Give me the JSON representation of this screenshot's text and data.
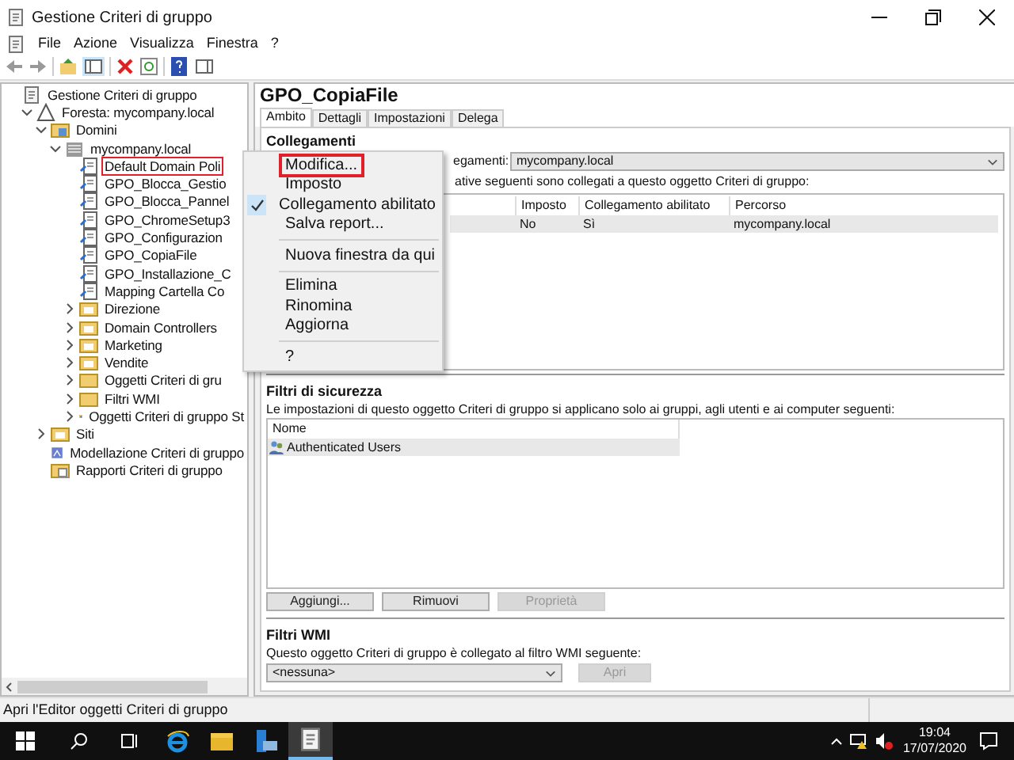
{
  "window": {
    "title": "Gestione Criteri di gruppo"
  },
  "menu_bar": [
    "File",
    "Azione",
    "Visualizza",
    "Finestra",
    "?"
  ],
  "tree": [
    {
      "label": "Gestione Criteri di gruppo",
      "kind": "root",
      "selected": false,
      "children": [
        {
          "label": "Foresta: mycompany.local",
          "kind": "forest",
          "expanded": true,
          "selected": false,
          "children": [
            {
              "label": "Domini",
              "kind": "domains",
              "expanded": true,
              "selected": false,
              "children": [
                {
                  "label": "mycompany.local",
                  "kind": "domain",
                  "expanded": true,
                  "selected": false,
                  "children": [
                    {
                      "label": "Default Domain Poli",
                      "kind": "link",
                      "selected": true
                    },
                    {
                      "label": "GPO_Blocca_Gestio",
                      "kind": "link",
                      "selected": false
                    },
                    {
                      "label": "GPO_Blocca_Pannel",
                      "kind": "link",
                      "selected": false
                    },
                    {
                      "label": "GPO_ChromeSetup3",
                      "kind": "link",
                      "selected": false
                    },
                    {
                      "label": "GPO_Configurazion",
                      "kind": "link",
                      "selected": false
                    },
                    {
                      "label": "GPO_CopiaFile",
                      "kind": "link",
                      "selected": false
                    },
                    {
                      "label": "GPO_Installazione_C",
                      "kind": "link",
                      "selected": false
                    },
                    {
                      "label": "Mapping Cartella Co",
                      "kind": "link",
                      "selected": false
                    },
                    {
                      "label": "Direzione",
                      "kind": "ou",
                      "expanded": false,
                      "selected": false
                    },
                    {
                      "label": "Domain Controllers",
                      "kind": "ou",
                      "expanded": false,
                      "selected": false
                    },
                    {
                      "label": "Marketing",
                      "kind": "ou",
                      "expanded": false,
                      "selected": false
                    },
                    {
                      "label": "Vendite",
                      "kind": "ou",
                      "expanded": false,
                      "selected": false
                    },
                    {
                      "label": "Oggetti Criteri di gru",
                      "kind": "folder",
                      "expanded": false,
                      "selected": false
                    },
                    {
                      "label": "Filtri WMI",
                      "kind": "folder",
                      "expanded": false,
                      "selected": false
                    },
                    {
                      "label": "Oggetti Criteri di gruppo St",
                      "kind": "starter",
                      "expanded": false,
                      "selected": false
                    }
                  ]
                }
              ]
            },
            {
              "label": "Siti",
              "kind": "ou",
              "expanded": false,
              "selected": false
            },
            {
              "label": "Modellazione Criteri di gruppo",
              "kind": "modeling",
              "selected": false
            },
            {
              "label": "Rapporti Criteri di gruppo",
              "kind": "results",
              "selected": false
            }
          ]
        }
      ]
    }
  ],
  "context_menu": [
    {
      "kind": "item",
      "label": "Modifica...",
      "checked": false,
      "highlighted": true
    },
    {
      "kind": "item",
      "label": "Imposto",
      "checked": false,
      "highlighted": false
    },
    {
      "kind": "item",
      "label": "Collegamento abilitato",
      "checked": true,
      "highlighted": false
    },
    {
      "kind": "item",
      "label": "Salva report...",
      "checked": false,
      "highlighted": false
    },
    {
      "kind": "separator"
    },
    {
      "kind": "item",
      "label": "Nuova finestra da qui",
      "checked": false,
      "highlighted": false
    },
    {
      "kind": "separator"
    },
    {
      "kind": "item",
      "label": "Elimina",
      "checked": false,
      "highlighted": false
    },
    {
      "kind": "item",
      "label": "Rinomina",
      "checked": false,
      "highlighted": false
    },
    {
      "kind": "item",
      "label": "Aggiorna",
      "checked": false,
      "highlighted": false
    },
    {
      "kind": "separator"
    },
    {
      "kind": "item",
      "label": "?",
      "checked": false,
      "highlighted": false
    }
  ],
  "details": {
    "title": "GPO_CopiaFile",
    "tabs": [
      {
        "label": "Ambito",
        "selected": true
      },
      {
        "label": "Dettagli",
        "selected": false
      },
      {
        "label": "Impostazioni",
        "selected": false
      },
      {
        "label": "Delega",
        "selected": false
      }
    ],
    "links": {
      "heading": "Collegamenti",
      "location_label": "egamenti:",
      "location_value": "mycompany.local",
      "description": "ative seguenti sono collegati a questo oggetto Criteri di gruppo:",
      "columns": [
        "Imposto",
        "Collegamento abilitato",
        "Percorso"
      ],
      "rows": [
        [
          "No",
          "Sì",
          "mycompany.local"
        ]
      ]
    },
    "security": {
      "heading": "Filtri di sicurezza",
      "description": "Le impostazioni di questo oggetto Criteri di gruppo si applicano solo ai gruppi, agli utenti e ai computer seguenti:",
      "columns": [
        "Nome"
      ],
      "rows": [
        {
          "name": "Authenticated Users",
          "selected": true
        }
      ],
      "buttons": [
        {
          "label": "Aggiungi...",
          "disabled": false
        },
        {
          "label": "Rimuovi",
          "disabled": false
        },
        {
          "label": "Proprietà",
          "disabled": true
        }
      ]
    },
    "wmi": {
      "heading": "Filtri WMI",
      "description": "Questo oggetto Criteri di gruppo è collegato al filtro WMI seguente:",
      "value": "<nessuna>",
      "button": {
        "label": "Apri",
        "disabled": true
      }
    }
  },
  "status_bar": "Apri l'Editor oggetti Criteri di gruppo",
  "taskbar": {
    "apps": [
      {
        "kind": "ie",
        "active": false
      },
      {
        "kind": "explorer",
        "active": false
      },
      {
        "kind": "server",
        "active": false
      },
      {
        "kind": "gpm",
        "active": true
      }
    ],
    "time": "19:04",
    "date": "17/07/2020"
  }
}
